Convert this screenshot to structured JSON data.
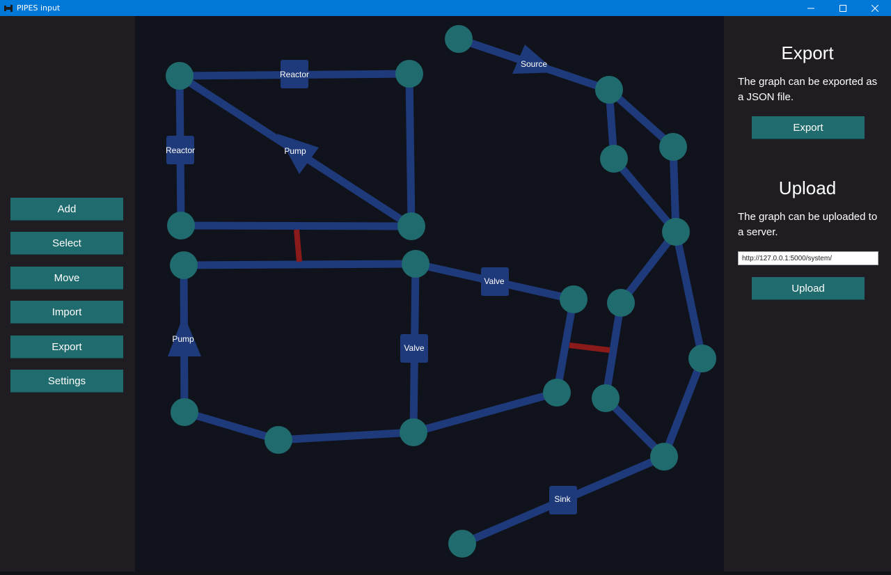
{
  "window": {
    "title": "PIPES input",
    "icon": "pipes-app-icon"
  },
  "window_controls": [
    "minimize-icon",
    "maximize-icon",
    "close-icon"
  ],
  "left_menu": {
    "add": "Add",
    "select": "Select",
    "move": "Move",
    "import": "Import",
    "export": "Export",
    "settings": "Settings"
  },
  "export_section": {
    "heading": "Export",
    "description": "The graph can be exported as a JSON file.",
    "button": "Export"
  },
  "upload_section": {
    "heading": "Upload",
    "description": "The graph can be uploaded to a server.",
    "url_value": "http://127.0.0.1:5000/system/",
    "button": "Upload"
  },
  "components": {
    "reactor_top": "Reactor",
    "reactor_left": "Reactor",
    "pump_diag": "Pump",
    "pump_left": "Pump",
    "valve_center": "Valve",
    "valve_right": "Valve",
    "source": "Source",
    "sink": "Sink"
  },
  "colors": {
    "pipe": "#1f3a7a",
    "node": "#1f6b6e",
    "component": "#1f3a7a",
    "cut_link": "#8b1a1a",
    "button": "#1f6b6e",
    "titlebar": "#0078d7"
  }
}
